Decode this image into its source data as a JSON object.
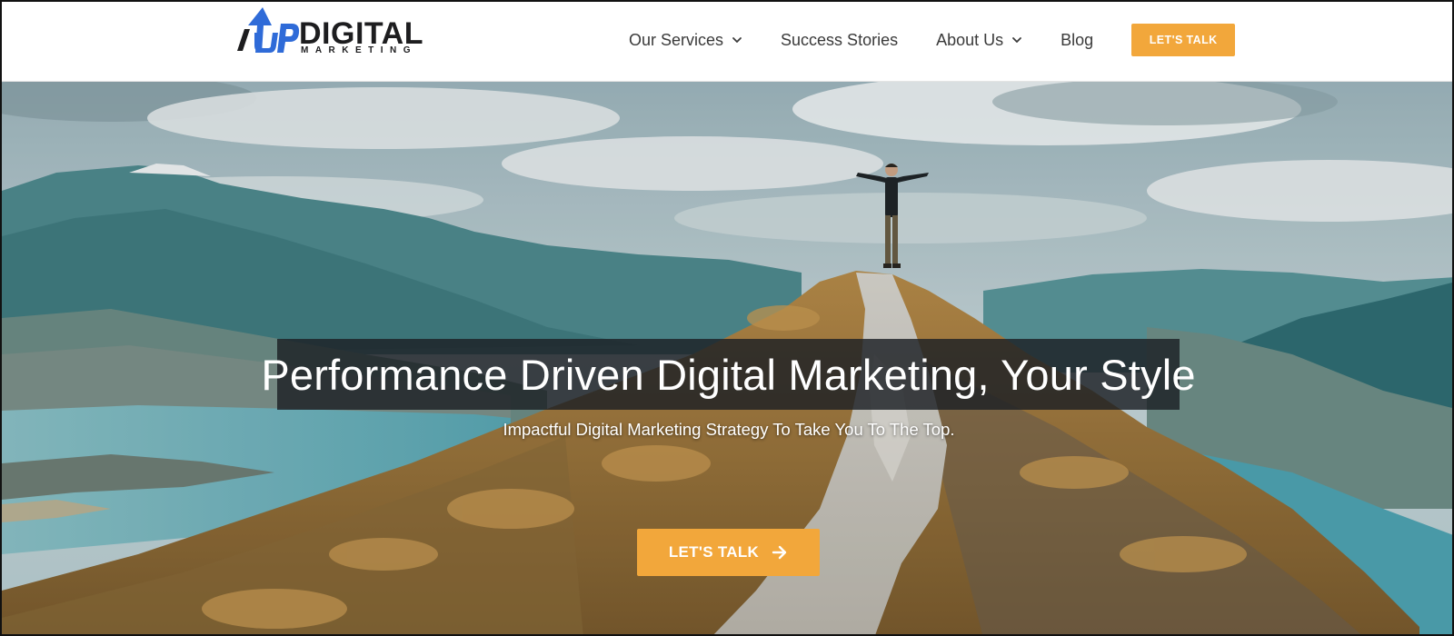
{
  "header": {
    "logo": {
      "mark_text": "1UP",
      "name": "DIGITAL",
      "tagline": "MARKETING",
      "icon": "arrow-up-logo-icon",
      "colors": {
        "blue": "#2f6bd8",
        "dark": "#1d1d1f"
      }
    },
    "nav": {
      "items": [
        {
          "label": "Our Services",
          "dropdown": true,
          "icon": "chevron-down-icon"
        },
        {
          "label": "Success Stories",
          "dropdown": false
        },
        {
          "label": "About Us",
          "dropdown": true,
          "icon": "chevron-down-icon"
        },
        {
          "label": "Blog",
          "dropdown": false
        }
      ],
      "cta_label": "LET'S TALK"
    }
  },
  "hero": {
    "headline": "Performance Driven Digital Marketing, Your Style",
    "subheadline": "Impactful Digital Marketing Strategy To Take You To The Top.",
    "cta_label": "LET'S TALK",
    "cta_icon": "arrow-right-icon",
    "background": "mountain-summit-photo"
  },
  "colors": {
    "accent": "#f2a73b",
    "nav_text": "#3a3a3a",
    "headline_box": "#1c2024"
  }
}
